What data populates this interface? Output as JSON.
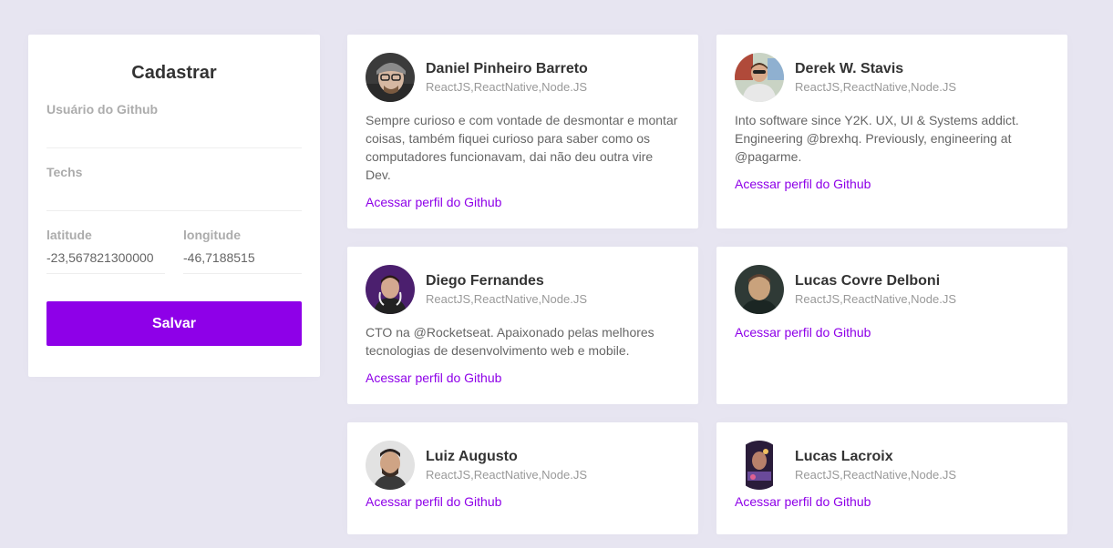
{
  "form": {
    "title": "Cadastrar",
    "github_username": {
      "label": "Usuário do Github",
      "value": ""
    },
    "techs": {
      "label": "Techs",
      "value": ""
    },
    "latitude": {
      "label": "latitude",
      "value": "-23,567821300000"
    },
    "longitude": {
      "label": "longitude",
      "value": "-46,7188515"
    },
    "save_label": "Salvar"
  },
  "colors": {
    "background": "#e7e5f1",
    "accent": "#8e00e8"
  },
  "devs": [
    {
      "name": "Daniel Pinheiro Barreto",
      "techs": "ReactJS,ReactNative,Node.JS",
      "bio": "Sempre curioso e com vontade de desmontar e montar coisas, também fiquei curioso para saber como os computadores funcionavam, dai não deu outra vire Dev.",
      "link_label": "Acessar perfil do Github"
    },
    {
      "name": "Derek W. Stavis",
      "techs": "ReactJS,ReactNative,Node.JS",
      "bio": "Into software since Y2K. UX, UI & Systems addict. Engineering @brexhq. Previously, engineering at @pagarme.",
      "link_label": "Acessar perfil do Github"
    },
    {
      "name": "Diego Fernandes",
      "techs": "ReactJS,ReactNative,Node.JS",
      "bio": "CTO na @Rocketseat. Apaixonado pelas melhores tecnologias de desenvolvimento web e mobile.",
      "link_label": "Acessar perfil do Github"
    },
    {
      "name": "Lucas Covre Delboni",
      "techs": "ReactJS,ReactNative,Node.JS",
      "bio": "",
      "link_label": "Acessar perfil do Github"
    },
    {
      "name": "Luiz Augusto",
      "techs": "ReactJS,ReactNative,Node.JS",
      "bio": "",
      "link_label": "Acessar perfil do Github"
    },
    {
      "name": "Lucas Lacroix",
      "techs": "ReactJS,ReactNative,Node.JS",
      "bio": "",
      "link_label": "Acessar perfil do Github"
    }
  ]
}
